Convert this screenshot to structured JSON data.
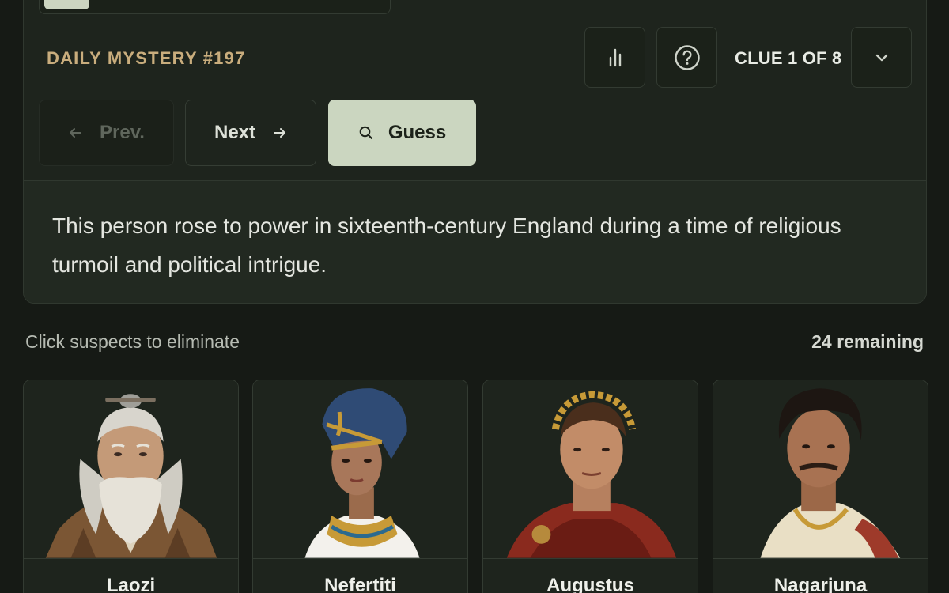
{
  "game": {
    "title": "DAILY MYSTERY #197",
    "clue_counter": "CLUE 1 OF 8",
    "progress": 0.125
  },
  "toolbar": {
    "stats_icon": "bar-chart-icon",
    "help_icon": "question-circle-icon",
    "expand_icon": "chevron-down-icon"
  },
  "nav": {
    "prev_label": "Prev.",
    "next_label": "Next",
    "guess_label": "Guess"
  },
  "clue": {
    "text": "This person rose to power in sixteenth-century England during a time of religious turmoil and political intrigue."
  },
  "suspects_header": {
    "hint": "Click suspects to eliminate",
    "remaining": "24 remaining"
  },
  "suspects": [
    {
      "name": "Laozi"
    },
    {
      "name": "Nefertiti"
    },
    {
      "name": "Augustus"
    },
    {
      "name": "Nagarjuna"
    }
  ],
  "colors": {
    "background": "#161a15",
    "panel": "#1e241d",
    "accent": "#c9ad7d",
    "guess_button": "#cbd6c0"
  }
}
